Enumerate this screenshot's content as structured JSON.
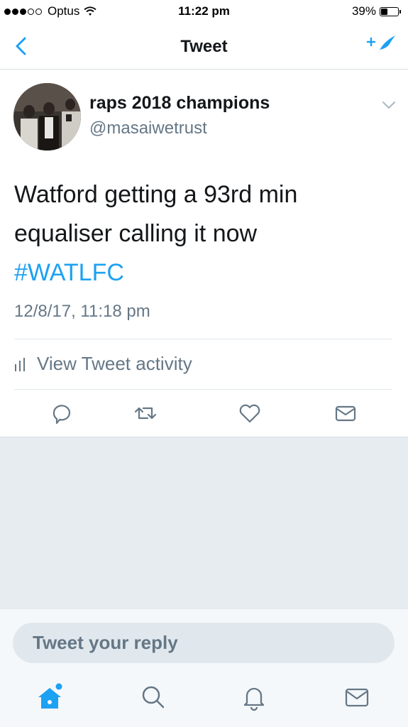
{
  "status_bar": {
    "carrier": "Optus",
    "time": "11:22 pm",
    "battery_percent": "39%",
    "battery_level": 0.39,
    "signal_bars": 3,
    "signal_max": 5
  },
  "nav": {
    "title": "Tweet",
    "back_icon": "chevron-left-icon",
    "compose_icon": "compose-tweet-icon"
  },
  "tweet": {
    "display_name": "raps 2018 champions",
    "handle": "@masaiwetrust",
    "text": "Watford getting a 93rd min equaliser calling it now",
    "hashtag": "#WATLFC",
    "timestamp": "12/8/17, 11:18 pm",
    "activity_label": "View Tweet activity",
    "actions": [
      "reply-icon",
      "retweet-icon",
      "like-icon",
      "direct-message-icon"
    ]
  },
  "reply": {
    "placeholder": "Tweet your reply"
  },
  "tab_bar": {
    "tabs": [
      "home-icon",
      "search-icon",
      "notifications-icon",
      "messages-icon"
    ]
  },
  "colors": {
    "accent": "#1da1f2",
    "secondary_text": "#657786",
    "background_gray": "#e6ecf0"
  }
}
